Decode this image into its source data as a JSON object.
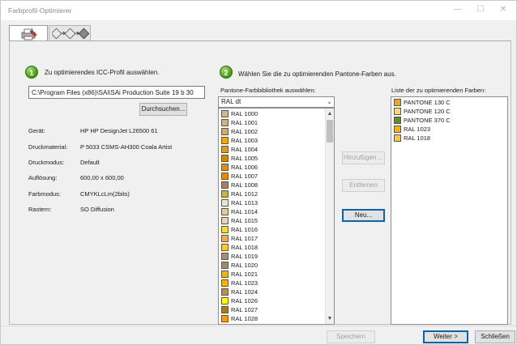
{
  "window": {
    "title": "Farbprofil-Optimierer",
    "minimize_glyph": "—",
    "maximize_glyph": "☐",
    "close_glyph": "✕"
  },
  "tabs": [
    {
      "name": "printer-settings",
      "icon": "printer-icon",
      "active": true
    },
    {
      "name": "optimization-steps",
      "icon": "workflow-icon",
      "active": false
    }
  ],
  "step1": {
    "number": "1",
    "text": "Zu optimierendes ICC-Profil auswählen.",
    "path_value": "C:\\Program Files (x86)\\SAi\\SAi Production Suite 19 b 30",
    "browse_label": "Durchsuchen..."
  },
  "info": [
    {
      "label": "Gerät:",
      "value": "HP HP DesignJet L26500 61"
    },
    {
      "label": "Druckmaterial:",
      "value": "P 5033 CSMS-AH300 Coala Artist"
    },
    {
      "label": "Druckmodus:",
      "value": "Default"
    },
    {
      "label": "Auflösung:",
      "value": "600,00 x 600,00"
    },
    {
      "label": "Farbmodus:",
      "value": "CMYKLcLm(2bits)"
    },
    {
      "label": "Rastern:",
      "value": "SO Diffusion"
    }
  ],
  "step2": {
    "number": "2",
    "text": "Wählen Sie die zu optimierenden Pantone-Farben aus.",
    "library_label": "Pantone-Farbbibliothek auswählen:",
    "library_selected": "RAL dt",
    "list_label": "Liste der zu optimierenden Farben:"
  },
  "library_colors": [
    {
      "name": "RAL 1000",
      "color": "#cdba88"
    },
    {
      "name": "RAL 1001",
      "color": "#d0b084"
    },
    {
      "name": "RAL 1002",
      "color": "#d2aa6d"
    },
    {
      "name": "RAL 1003",
      "color": "#f9a800"
    },
    {
      "name": "RAL 1004",
      "color": "#e49e00"
    },
    {
      "name": "RAL 1005",
      "color": "#cb8e00"
    },
    {
      "name": "RAL 1006",
      "color": "#e29000"
    },
    {
      "name": "RAL 1007",
      "color": "#e88c00"
    },
    {
      "name": "RAL 1008",
      "color": "#a97f5a"
    },
    {
      "name": "RAL 1012",
      "color": "#c7b446"
    },
    {
      "name": "RAL 1013",
      "color": "#eae6ca"
    },
    {
      "name": "RAL 1014",
      "color": "#e1cc96"
    },
    {
      "name": "RAL 1015",
      "color": "#e6d2b5"
    },
    {
      "name": "RAL 1016",
      "color": "#f1dd38"
    },
    {
      "name": "RAL 1017",
      "color": "#f6a950"
    },
    {
      "name": "RAL 1018",
      "color": "#faca30"
    },
    {
      "name": "RAL 1019",
      "color": "#a48f7a"
    },
    {
      "name": "RAL 1020",
      "color": "#a08f65"
    },
    {
      "name": "RAL 1021",
      "color": "#f6b600"
    },
    {
      "name": "RAL 1023",
      "color": "#f7b500"
    },
    {
      "name": "RAL 1024",
      "color": "#ba8f4c"
    },
    {
      "name": "RAL 1026",
      "color": "#ffff00"
    },
    {
      "name": "RAL 1027",
      "color": "#a77f0e"
    },
    {
      "name": "RAL 1028",
      "color": "#ff9b00"
    }
  ],
  "selected_colors": [
    {
      "name": "PANTONE 130 C",
      "color": "#f2a900"
    },
    {
      "name": "PANTONE 120 C",
      "color": "#fbd872"
    },
    {
      "name": "PANTONE 370 C",
      "color": "#658d1b"
    },
    {
      "name": "RAL 1023",
      "color": "#f7b500"
    },
    {
      "name": "RAL 1018",
      "color": "#faca30"
    }
  ],
  "actions": {
    "add_label": "Hinzufügen ...",
    "remove_label": "Entfernen",
    "new_label": "Neu..."
  },
  "footer": {
    "save_label": "Speichern",
    "next_label": "Weiter >",
    "close_label": "Schließen"
  },
  "scroll": {
    "library_up": "▲",
    "library_down": "▼",
    "dropdown_arrow": "⌄"
  }
}
